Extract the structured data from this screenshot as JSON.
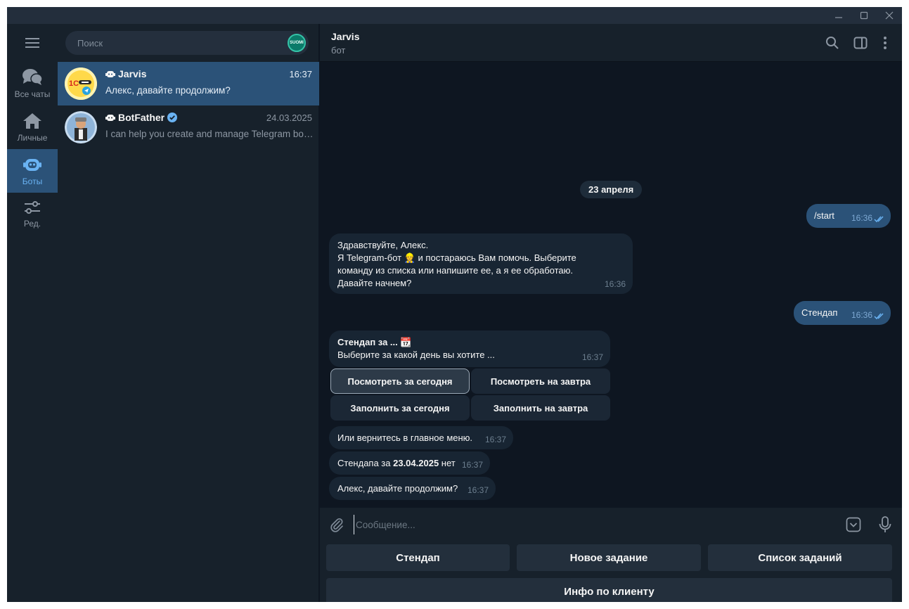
{
  "nav": {
    "folders": [
      {
        "label": "Все чаты",
        "icon": "chats-icon",
        "active": false
      },
      {
        "label": "Личные",
        "icon": "home-icon",
        "active": false
      },
      {
        "label": "Боты",
        "icon": "bot-icon",
        "active": true
      },
      {
        "label": "Ред.",
        "icon": "sliders-icon",
        "active": false
      }
    ]
  },
  "search": {
    "placeholder": "Поиск",
    "badge": "SUOMI"
  },
  "chats": [
    {
      "name": "Jarvis",
      "time": "16:37",
      "preview": "Алекс, давайте продолжим?",
      "active": true
    },
    {
      "name": "BotFather",
      "time": "24.03.2025",
      "preview": "I can help you create and manage Telegram bots...",
      "verified": true,
      "active": false
    }
  ],
  "header": {
    "title": "Jarvis",
    "subtitle": "бот"
  },
  "conversation": {
    "date": "23 апреля",
    "messages": [
      {
        "dir": "out",
        "text": "/start",
        "time": "16:36"
      },
      {
        "dir": "in",
        "lines": [
          "Здравствуйте, Алекс.",
          "Я Telegram-бот 👷 и постараюсь Вам помочь. Выберите",
          "команду из списка или напишите ее, а я ее обработаю.",
          "Давайте начнем?"
        ],
        "time": "16:36"
      },
      {
        "dir": "out",
        "text": "Стендап",
        "time": "16:36"
      },
      {
        "dir": "in",
        "title": "Стендап за ... 📆",
        "text": "Выберите за какой день вы хотите ...",
        "time": "16:37"
      },
      {
        "dir": "in",
        "text": "Или вернитесь в главное меню.",
        "time": "16:37"
      },
      {
        "dir": "in",
        "prefix": "Стендапа за ",
        "bold": "23.04.2025",
        "suffix": " нет",
        "time": "16:37"
      },
      {
        "dir": "in",
        "text": "Алекс, давайте продолжим?",
        "time": "16:37"
      }
    ],
    "inline_keyboard": [
      "Посмотреть за сегодня",
      "Посмотреть на завтра",
      "Заполнить за сегодня",
      "Заполнить на завтра"
    ]
  },
  "composer": {
    "placeholder": "Сообщение..."
  },
  "reply_keyboard": [
    "Стендап",
    "Новое задание",
    "Список заданий",
    "Инфо по клиенту"
  ],
  "colors": {
    "accent": "#2b5278",
    "link": "#6ab3f3",
    "bg": "#0e1621",
    "panel": "#17212b"
  }
}
